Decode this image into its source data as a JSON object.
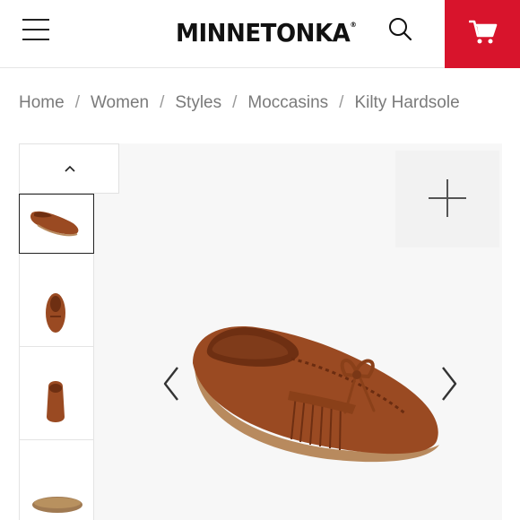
{
  "header": {
    "logo_text": "MINNETONKA",
    "logo_mark": "®",
    "menu_icon": "hamburger-menu-icon",
    "search_icon": "search-icon",
    "cart_icon": "cart-icon",
    "cart_color": "#d8142c"
  },
  "breadcrumb": {
    "items": [
      "Home",
      "Women",
      "Styles",
      "Moccasins",
      "Kilty Hardsole"
    ],
    "separator": "/"
  },
  "gallery": {
    "thumbnails": [
      {
        "view": "side",
        "selected": true
      },
      {
        "view": "top",
        "selected": false
      },
      {
        "view": "back",
        "selected": false
      },
      {
        "view": "sole",
        "selected": false
      }
    ],
    "zoom_icon": "plus-icon",
    "prev_icon": "chevron-left-icon",
    "next_icon": "chevron-right-icon",
    "up_icon": "chevron-up-icon",
    "product_color": "#9a4a22"
  }
}
